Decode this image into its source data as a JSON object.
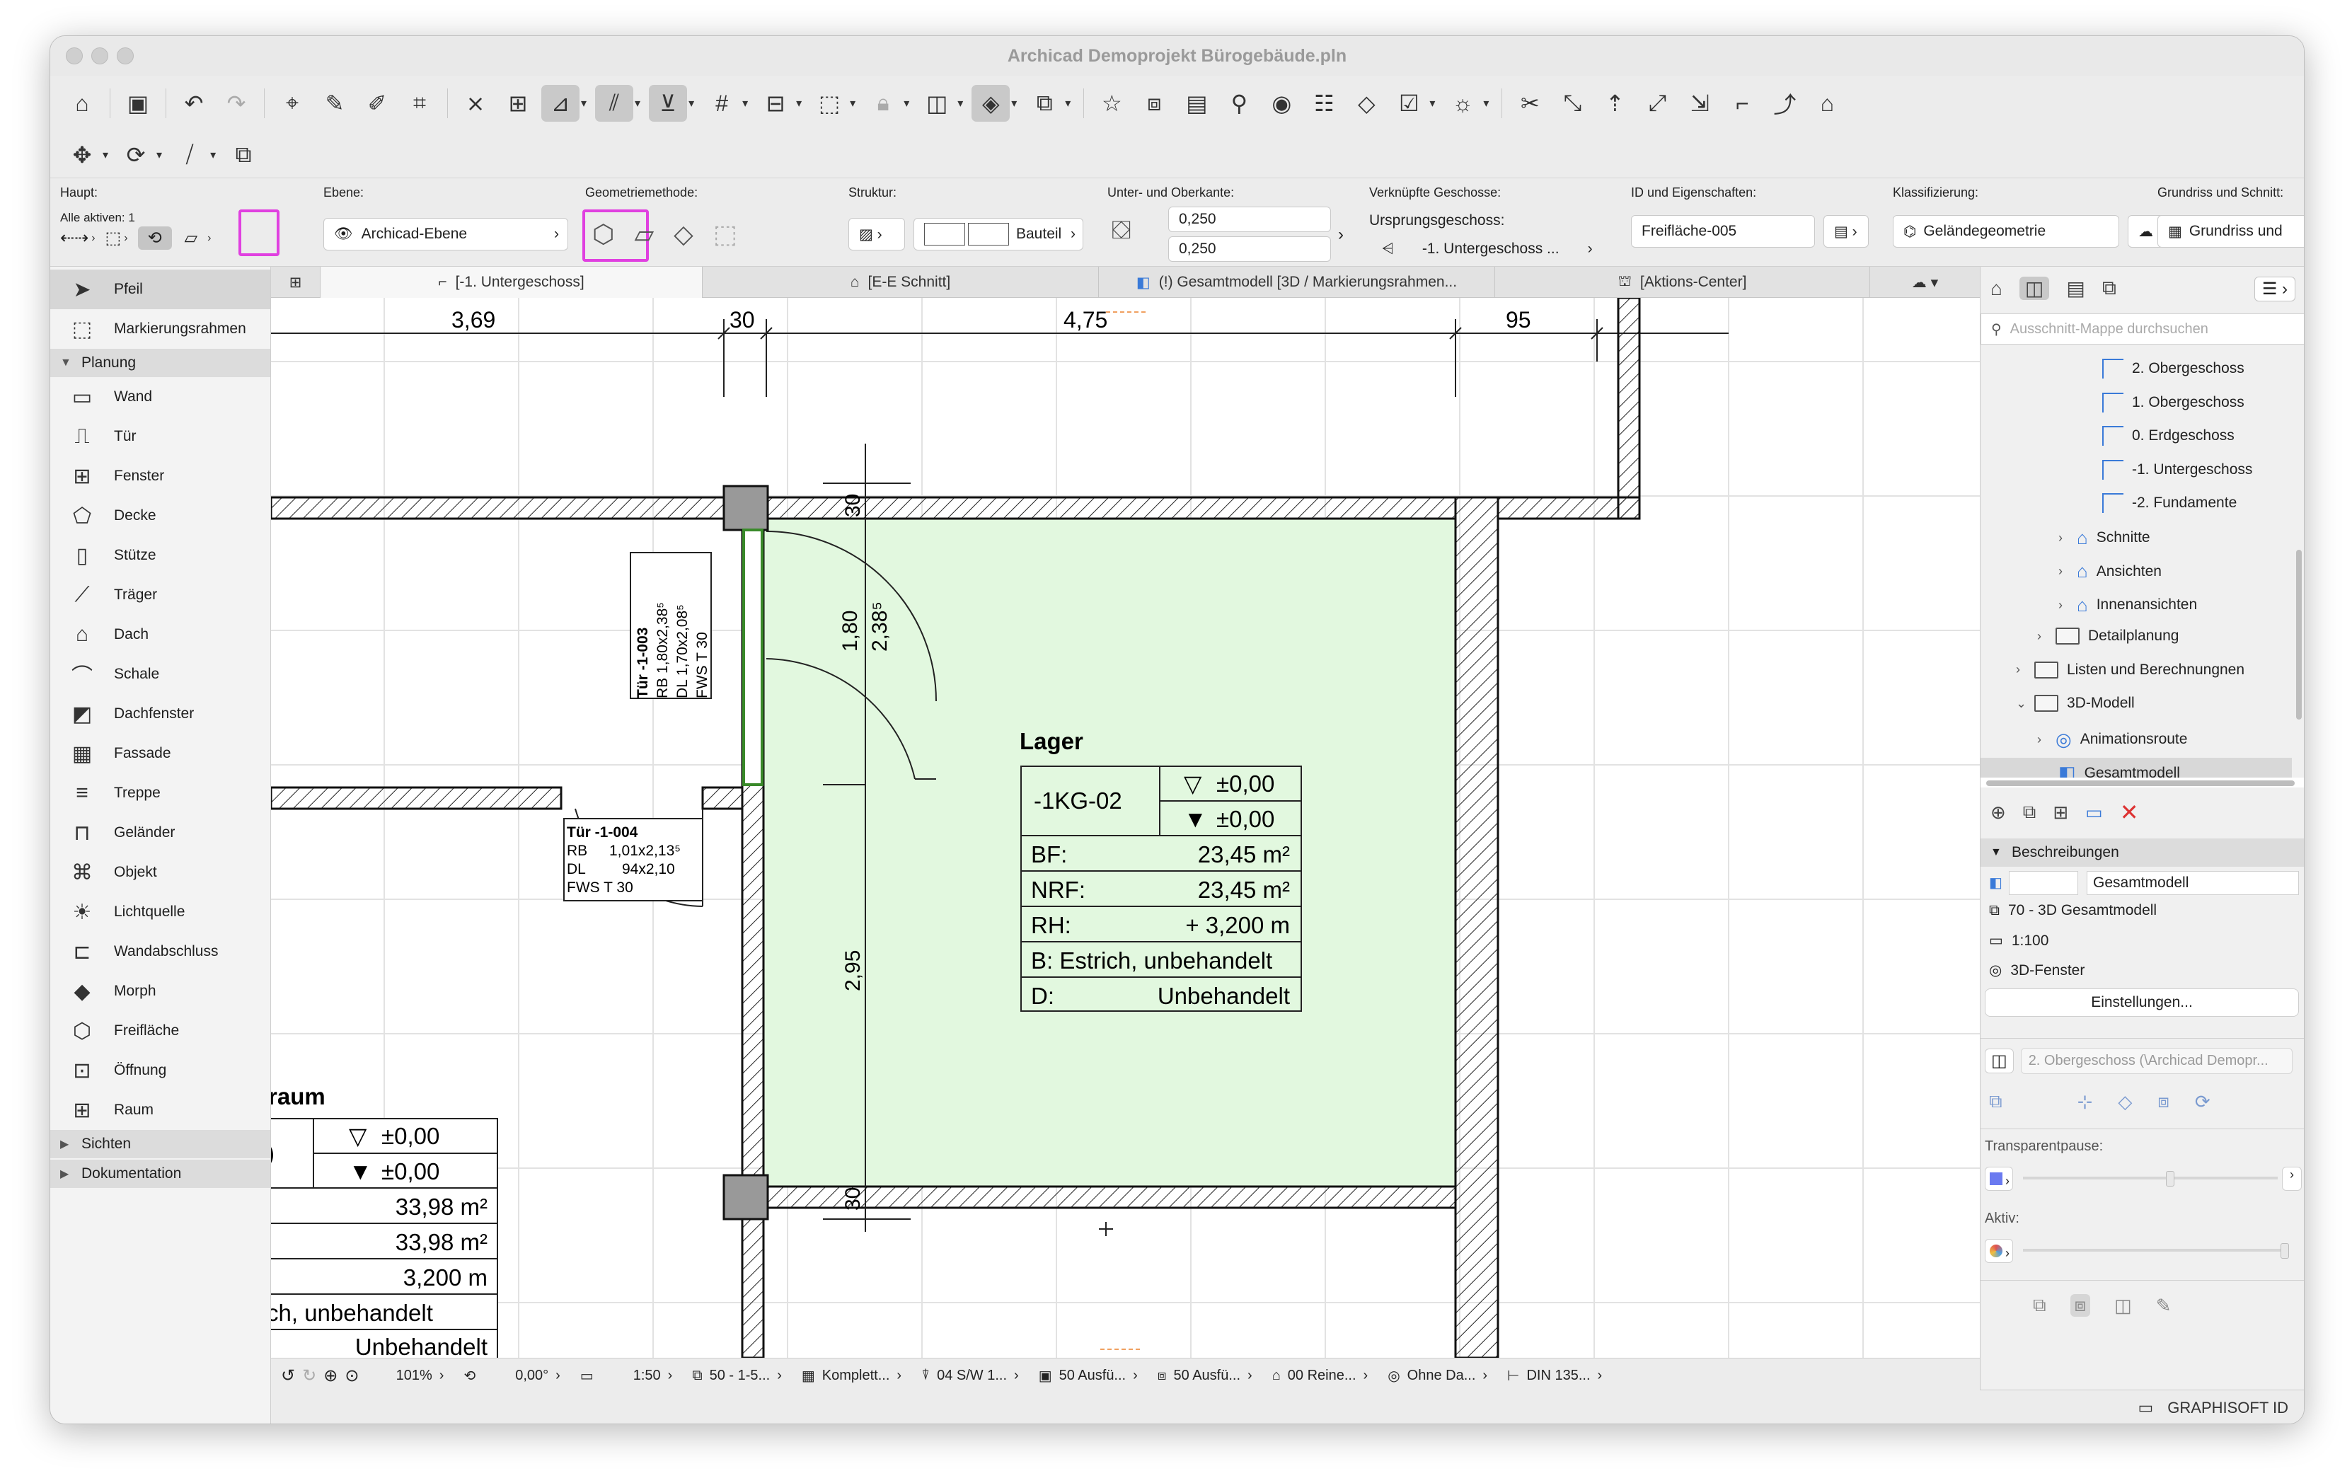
{
  "window": {
    "title": "Archicad Demoprojekt Bürogebäude.pln"
  },
  "info_box": {
    "haupt_label": "Haupt:",
    "alle_aktiven": "Alle aktiven: 1",
    "ebene_label": "Ebene:",
    "ebene_value": "Archicad-Ebene",
    "geometrie_label": "Geometriemethode:",
    "struktur_label": "Struktur:",
    "struktur_value": "Bauteil",
    "unter_label": "Unter- und Oberkante:",
    "unter_top": "0,250",
    "unter_bottom": "0,250",
    "verkn_label": "Verknüpfte Geschosse:",
    "ursprung_label": "Ursprungsgeschoss:",
    "ursprung_value": "-1. Untergeschoss ...",
    "id_label": "ID und Eigenschaften:",
    "id_value": "Freifläche-005",
    "klass_label": "Klassifizierung:",
    "klass_value": "Geländegeometrie",
    "grundriss_label": "Grundriss und Schnitt:",
    "grundriss_value": "Grundriss und"
  },
  "toolbox": {
    "pfeil": "Pfeil",
    "markierungsrahmen": "Markierungsrahmen",
    "group_planung": "Planung",
    "tools": [
      "Wand",
      "Tür",
      "Fenster",
      "Decke",
      "Stütze",
      "Träger",
      "Dach",
      "Schale",
      "Dachfenster",
      "Fassade",
      "Treppe",
      "Geländer",
      "Objekt",
      "Lichtquelle",
      "Wandabschluss",
      "Morph",
      "Freifläche",
      "Öffnung",
      "Raum"
    ],
    "group_sichten": "Sichten",
    "group_dokumentation": "Dokumentation"
  },
  "tabs": [
    "[-1. Untergeschoss]",
    "[E-E Schnitt]",
    "(!) Gesamtmodell [3D / Markierungsrahmen...",
    "[Aktions-Center]"
  ],
  "plan": {
    "dims": [
      "3,69",
      "30",
      "4,75",
      "95"
    ],
    "wall_dims": [
      "30",
      "30"
    ],
    "vert_dims": [
      "1,80",
      "2,38⁵",
      "2,95"
    ],
    "tuer_1003": {
      "id": "Tür -1-003",
      "rb": "RB     1,80x2,38⁵",
      "dl": "DL     1,70x2,08⁵",
      "fws": "FWS  T 30"
    },
    "tuer_1004": {
      "id": "Tür -1-004",
      "rb": "RB",
      "rb_val": "1,01x2,13⁵",
      "dl": "DL",
      "dl_val": "94x2,10",
      "fws": "FWS  T 30"
    },
    "lager": {
      "name": "Lager",
      "code": "-1KG-02",
      "top": "±0,00",
      "bottom": "±0,00",
      "bf_label": "BF:",
      "bf_val": "23,45 m²",
      "nrf_label": "NRF:",
      "nrf_val": "23,45 m²",
      "rh_label": "RH:",
      "rh_val": "+ 3,200 m",
      "b": "B: Estrich, unbehandelt",
      "d_label": "D:",
      "d_val": "Unbehandelt"
    },
    "raum": {
      "name": "raum",
      "code": ")",
      "top": "±0,00",
      "bottom": "±0,00",
      "bf": "33,98 m²",
      "nrf": "33,98 m²",
      "rh": "3,200 m",
      "b": "ch, unbehandelt",
      "d": "Unbehandelt"
    }
  },
  "status_bar": {
    "zoom": "101%",
    "angle": "0,00°",
    "scale": "1:50",
    "layer_combo": "50 - 1-5...",
    "pen": "Komplett...",
    "model": "04 S/W 1...",
    "struct": "50 Ausfü...",
    "struct2": "50 Ausfü...",
    "renov": "00 Reine...",
    "ohne": "Ohne Da...",
    "din": "DIN 135..."
  },
  "navigator": {
    "search_placeholder": "Ausschnitt-Mappe durchsuchen",
    "items": [
      "2. Obergeschoss",
      "1. Obergeschoss",
      "0. Erdgeschoss",
      "-1. Untergeschoss",
      "-2. Fundamente",
      "Schnitte",
      "Ansichten",
      "Innenansichten",
      "Detailplanung",
      "Listen und Berechnungnen",
      "3D-Modell",
      "Animationsroute",
      "Gesamtmodell"
    ],
    "beschreibungen": "Beschreibungen",
    "name_value": "Gesamtmodell",
    "layer_combo": "70 - 3D Gesamtmodell",
    "scale": "1:100",
    "window": "3D-Fenster",
    "settings_button": "Einstellungen...",
    "viewpoint": "2. Obergeschoss (\\Archicad Demopr...",
    "transparent_label": "Transparentpause:",
    "aktiv_label": "Aktiv:",
    "graphisoft": "GRAPHISOFT ID"
  }
}
